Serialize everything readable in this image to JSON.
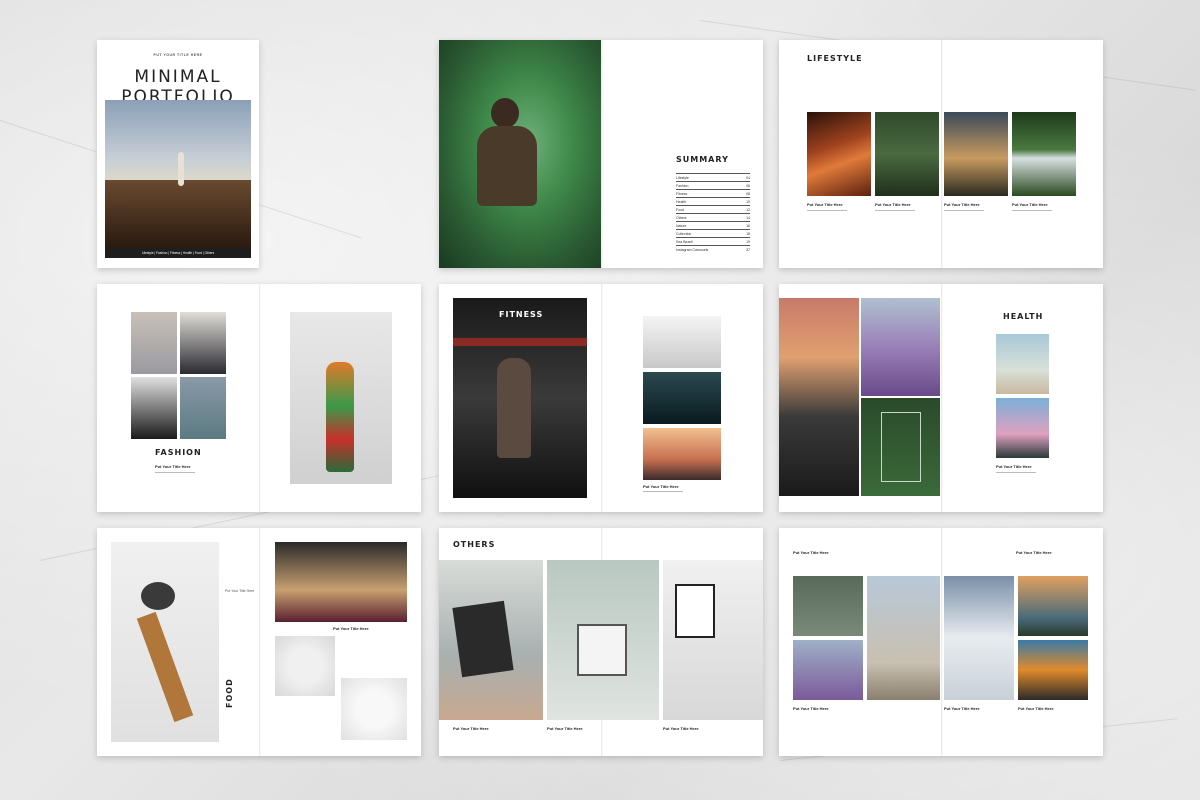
{
  "cover": {
    "kicker": "PUT YOUR TITLE HERE",
    "title_line1": "MINIMAL",
    "title_line2": "PORTFOLIO",
    "footer": "Lifestyle | Fashion | Fitness | Health | Food | Others"
  },
  "summary": {
    "title": "SUMMARY",
    "entries": [
      {
        "label": "Lifestyle",
        "page": "04"
      },
      {
        "label": "Fashion",
        "page": "06"
      },
      {
        "label": "Fitness",
        "page": "08"
      },
      {
        "label": "Health",
        "page": "10"
      },
      {
        "label": "Food",
        "page": "12"
      },
      {
        "label": "Others",
        "page": "14"
      },
      {
        "label": "Nature",
        "page": "16"
      },
      {
        "label": "Collection",
        "page": "18"
      },
      {
        "label": "Sea Beach",
        "page": "19"
      },
      {
        "label": "Instagram Carousels",
        "page": "37"
      }
    ]
  },
  "sections": {
    "lifestyle": "LIFESTYLE",
    "fashion": "FASHION",
    "fitness": "FITNESS",
    "health": "HEALTH",
    "food": "FOOD",
    "others": "OTHERS"
  },
  "placeholder": {
    "title": "Put Your Title Here",
    "body": "Sedit, aut fugitiuri antem nimium lorem ipsum dolor sit amet"
  },
  "colors": {
    "text": "#222222",
    "accent_green": "#3f8a4a",
    "page": "#ffffff"
  }
}
